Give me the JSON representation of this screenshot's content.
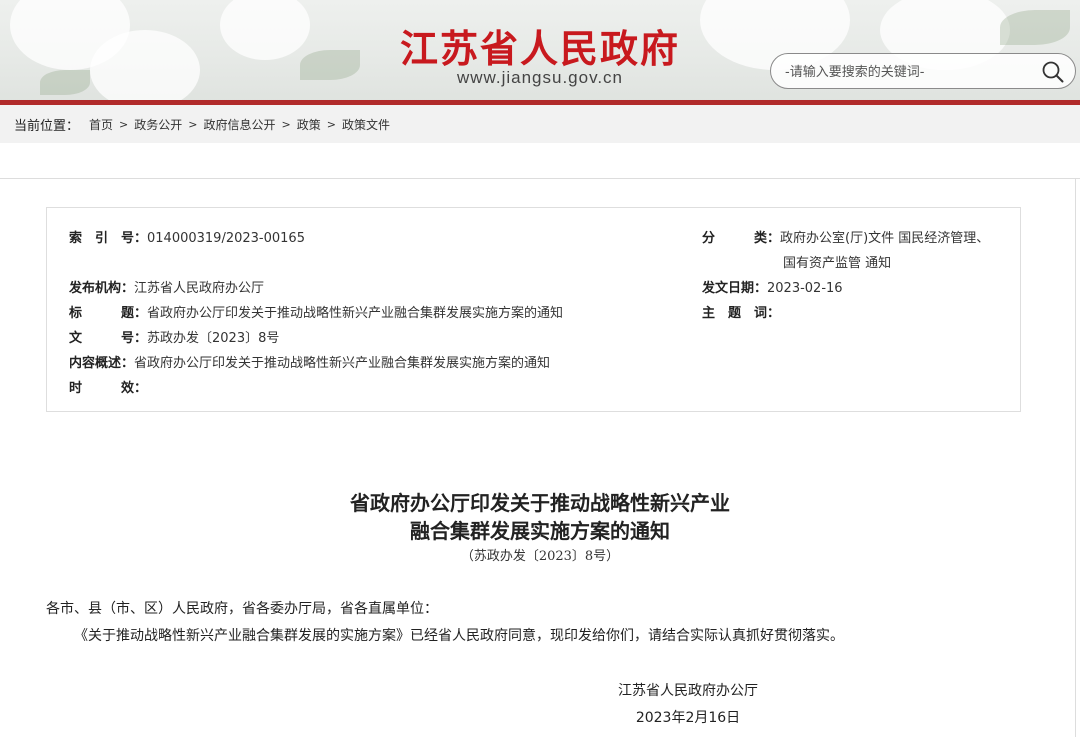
{
  "header": {
    "site_title": "江苏省人民政府",
    "site_url": "www.jiangsu.gov.cn",
    "search_placeholder": "-请输入要搜索的关键词-",
    "brand_color": "#c8191e"
  },
  "breadcrumb": {
    "label": "当前位置：",
    "items": [
      "首页",
      "政务公开",
      "政府信息公开",
      "政策",
      "政策文件"
    ],
    "separator": ">"
  },
  "info": {
    "index_key": "索　引　号：",
    "index_val": "014000319/2023-00165",
    "category_key": "分　　　类：",
    "category_val_1": "政府办公室(厅)文件 国民经济管理、",
    "category_val_2": "国有资产监管 通知",
    "issuer_key": "发布机构：",
    "issuer_val": "江苏省人民政府办公厅",
    "date_key": "发文日期：",
    "date_val": "2023-02-16",
    "title_key": "标　　　题：",
    "title_val": "省政府办公厅印发关于推动战略性新兴产业融合集群发展实施方案的通知",
    "subject_key": "主　题　词：",
    "subject_val": "",
    "docno_key": "文　　　号：",
    "docno_val": "苏政办发〔2023〕8号",
    "summary_key": "内容概述：",
    "summary_val": "省政府办公厅印发关于推动战略性新兴产业融合集群发展实施方案的通知",
    "validity_key": "时　　　效：",
    "validity_val": ""
  },
  "article": {
    "title_line1": "省政府办公厅印发关于推动战略性新兴产业",
    "title_line2": "融合集群发展实施方案的通知",
    "doc_no": "（苏政办发〔2023〕8号）",
    "salutation": "各市、县（市、区）人民政府，省各委办厅局，省各直属单位：",
    "body": "《关于推动战略性新兴产业融合集群发展的实施方案》已经省人民政府同意，现印发给你们，请结合实际认真抓好贯彻落实。",
    "sign_org": "江苏省人民政府办公厅",
    "sign_date": "2023年2月16日"
  }
}
